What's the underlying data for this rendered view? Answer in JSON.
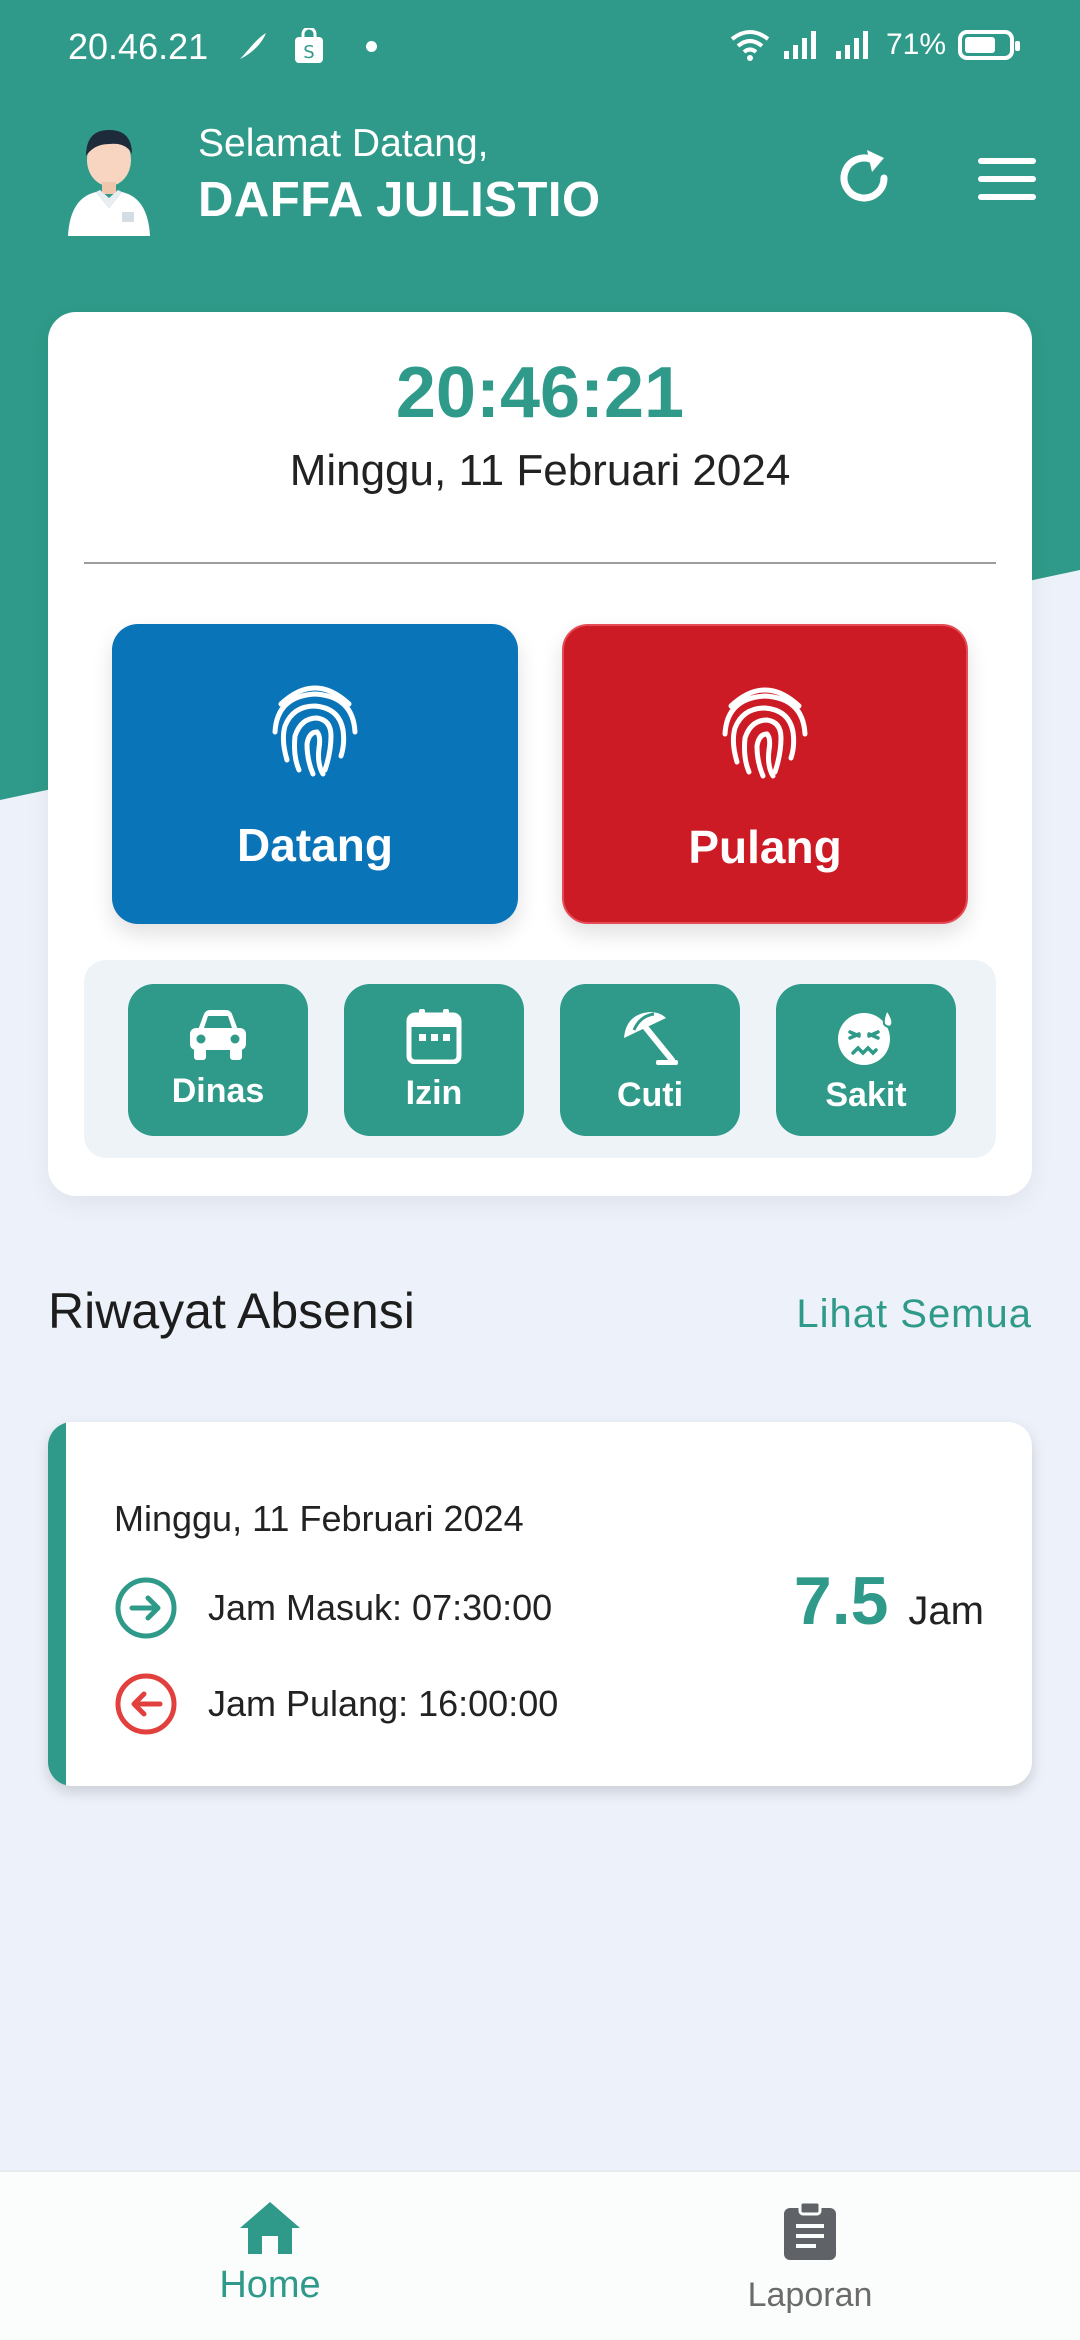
{
  "status_bar": {
    "time": "20.46.21",
    "battery": "71%",
    "battery_level": 0.71
  },
  "header": {
    "greeting": "Selamat Datang,",
    "user_name": "DAFFA JULISTIO"
  },
  "card": {
    "clock": "20:46:21",
    "date": "Minggu, 11 Februari 2024"
  },
  "attendance_buttons": {
    "datang": "Datang",
    "pulang": "Pulang"
  },
  "quick_actions": [
    {
      "label": "Dinas",
      "icon": "car-icon"
    },
    {
      "label": "Izin",
      "icon": "calendar-icon"
    },
    {
      "label": "Cuti",
      "icon": "beach-umbrella-icon"
    },
    {
      "label": "Sakit",
      "icon": "sick-face-icon"
    }
  ],
  "history": {
    "title": "Riwayat Absensi",
    "see_all": "Lihat Semua",
    "entry": {
      "date": "Minggu, 11 Februari 2024",
      "jam_masuk": "Jam Masuk: 07:30:00",
      "jam_pulang": "Jam Pulang: 16:00:00",
      "hours_value": "7.5",
      "hours_unit": "Jam"
    }
  },
  "bottom_nav": {
    "home": "Home",
    "laporan": "Laporan"
  },
  "colors": {
    "primary": "#2f9a89",
    "datang": "#0a74b8",
    "pulang": "#cc1b25",
    "background": "#edf1f9",
    "exit_red": "#e2403c"
  }
}
